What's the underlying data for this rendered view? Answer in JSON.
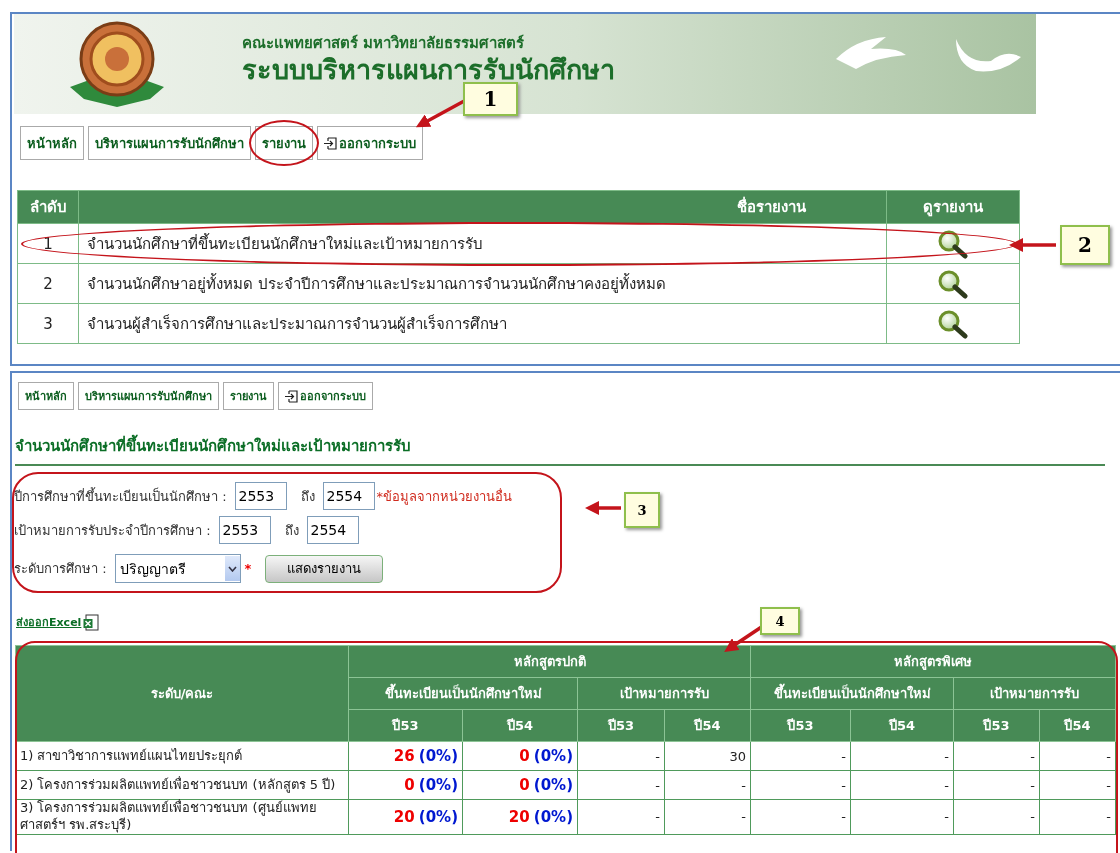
{
  "banner": {
    "subtitle": "คณะแพทยศาสตร์ มหาวิทยาลัยธรรมศาสตร์",
    "title": "ระบบบริหารแผนการรับนักศึกษา"
  },
  "top_nav": [
    {
      "label": "หน้าหลัก",
      "kind": "plain"
    },
    {
      "label": "บริหารแผนการรับนักศึกษา",
      "kind": "plain"
    },
    {
      "label": "รายงาน",
      "kind": "plain"
    },
    {
      "label": "ออกจากระบบ",
      "kind": "logout"
    }
  ],
  "report_list": {
    "columns": [
      "ลำดับ",
      "ชื่อรายงาน",
      "ดูรายงาน"
    ],
    "rows": [
      {
        "number": "1",
        "name": "จำนวนนักศึกษาที่ขึ้นทะเบียนนักศึกษาใหม่และเป้าหมายการรับ"
      },
      {
        "number": "2",
        "name": "จำนวนนักศึกษาอยู่ทั้งหมด ประจำปีการศึกษาและประมาณการจำนวนนักศึกษาคงอยู่ทั้งหมด"
      },
      {
        "number": "3",
        "name": "จำนวนผู้สำเร็จการศึกษาและประมาณการจำนวนผู้สำเร็จการศึกษา"
      }
    ]
  },
  "report_nav": [
    {
      "label": "หน้าหลัก",
      "kind": "plain"
    },
    {
      "label": "บริหารแผนการรับนักศึกษา",
      "kind": "plain"
    },
    {
      "label": "รายงาน",
      "kind": "plain"
    },
    {
      "label": "ออกจากระบบ",
      "kind": "logout"
    }
  ],
  "report_title": "จำนวนนักศึกษาที่ขึ้นทะเบียนนักศึกษาใหม่และเป้าหมายการรับ",
  "filter_form": {
    "year_rows": [
      {
        "label": "ปีการศึกษาที่ขึ้นทะเบียนเป็นนักศึกษา :",
        "from": "2553",
        "to_label": "ถึง",
        "to": "2554",
        "note": "*ข้อมูลจากหน่วยงานอื่น"
      },
      {
        "label": "เป้าหมายการรับประจำปีการศึกษา :",
        "from": "2553",
        "to_label": "ถึง",
        "to": "2554"
      }
    ],
    "level_label": "ระดับการศึกษา :",
    "level_value": "ปริญญาตรี",
    "required_mark": "*",
    "submit": "แสดงรายงาน"
  },
  "export_link": "ส่งออกExcel",
  "stats_table": {
    "row_header": "ระดับ/คณะ",
    "groups": [
      {
        "label": "หลักสูตรปกติ",
        "subgroups": [
          "ขึ้นทะเบียนเป็นนักศึกษาใหม่",
          "เป้าหมายการรับ"
        ]
      },
      {
        "label": "หลักสูตรพิเศษ",
        "subgroups": [
          "ขึ้นทะเบียนเป็นนักศึกษาใหม่",
          "เป้าหมายการรับ"
        ]
      }
    ],
    "years": [
      "ปี53",
      "ปี54",
      "ปี53",
      "ปี54",
      "ปี53",
      "ปี54",
      "ปี53",
      "ปี54"
    ],
    "rows": [
      {
        "name": "1) สาขาวิชาการแพทย์แผนไทยประยุกต์",
        "cells": [
          {
            "kind": "ratio",
            "count": "26",
            "percent": "(0%)"
          },
          {
            "kind": "ratio",
            "count": "0",
            "percent": "(0%)"
          },
          {
            "kind": "plain",
            "text": "-"
          },
          {
            "kind": "plain",
            "text": "30"
          },
          {
            "kind": "plain",
            "text": "-"
          },
          {
            "kind": "plain",
            "text": "-"
          },
          {
            "kind": "plain",
            "text": "-"
          },
          {
            "kind": "plain",
            "text": "-"
          }
        ]
      },
      {
        "name": "2) โครงการร่วมผลิตแพทย์เพื่อชาวชนบท (หลักสูตร 5 ปี)",
        "cells": [
          {
            "kind": "ratio",
            "count": "0",
            "percent": "(0%)"
          },
          {
            "kind": "ratio",
            "count": "0",
            "percent": "(0%)"
          },
          {
            "kind": "plain",
            "text": "-"
          },
          {
            "kind": "plain",
            "text": "-"
          },
          {
            "kind": "plain",
            "text": "-"
          },
          {
            "kind": "plain",
            "text": "-"
          },
          {
            "kind": "plain",
            "text": "-"
          },
          {
            "kind": "plain",
            "text": "-"
          }
        ]
      },
      {
        "name": "3) โครงการร่วมผลิตแพทย์เพื่อชาวชนบท (ศูนย์แพทยศาสตร์ฯ รพ.สระบุรี)",
        "cells": [
          {
            "kind": "ratio",
            "count": "20",
            "percent": "(0%)"
          },
          {
            "kind": "ratio",
            "count": "20",
            "percent": "(0%)"
          },
          {
            "kind": "plain",
            "text": "-"
          },
          {
            "kind": "plain",
            "text": "-"
          },
          {
            "kind": "plain",
            "text": "-"
          },
          {
            "kind": "plain",
            "text": "-"
          },
          {
            "kind": "plain",
            "text": "-"
          },
          {
            "kind": "plain",
            "text": "-"
          }
        ]
      }
    ]
  },
  "callouts": [
    {
      "label": "1"
    },
    {
      "label": "2"
    },
    {
      "label": "3"
    },
    {
      "label": "4"
    }
  ]
}
